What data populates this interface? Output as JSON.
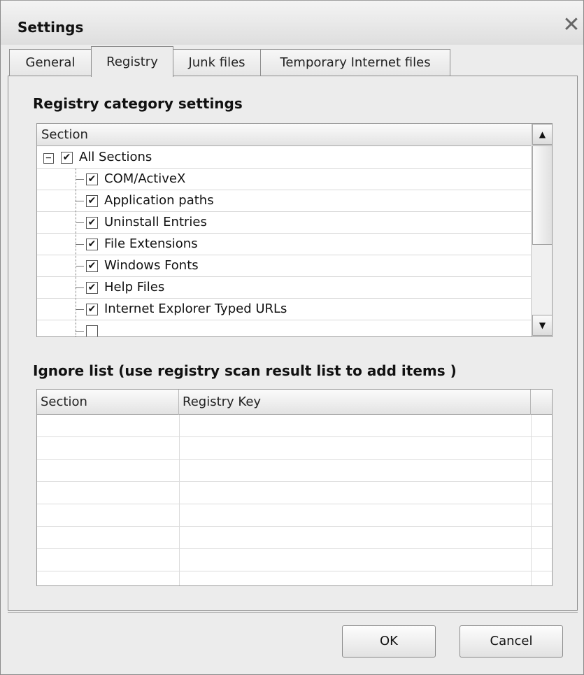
{
  "window": {
    "title": "Settings",
    "close_glyph": "✕"
  },
  "tabs": [
    {
      "label": "General",
      "active": false
    },
    {
      "label": "Registry",
      "active": true
    },
    {
      "label": "Junk files",
      "active": false
    },
    {
      "label": "Temporary Internet files",
      "active": false
    }
  ],
  "registry": {
    "heading": "Registry category settings",
    "tree_header": "Section",
    "root": {
      "label": "All Sections",
      "checked": true,
      "expanded": true,
      "expander_glyph": "−"
    },
    "items": [
      {
        "label": "COM/ActiveX",
        "checked": true
      },
      {
        "label": "Application paths",
        "checked": true
      },
      {
        "label": "Uninstall Entries",
        "checked": true
      },
      {
        "label": "File Extensions",
        "checked": true
      },
      {
        "label": "Windows Fonts",
        "checked": true
      },
      {
        "label": "Help Files",
        "checked": true
      },
      {
        "label": "Internet Explorer Typed URLs",
        "checked": true
      }
    ],
    "checkmark_glyph": "✔",
    "scroll_up_glyph": "▲",
    "scroll_down_glyph": "▼"
  },
  "ignore": {
    "heading": "Ignore list (use registry scan result list to add items )",
    "columns": [
      "Section",
      "Registry Key"
    ]
  },
  "buttons": {
    "ok": "OK",
    "cancel": "Cancel"
  }
}
